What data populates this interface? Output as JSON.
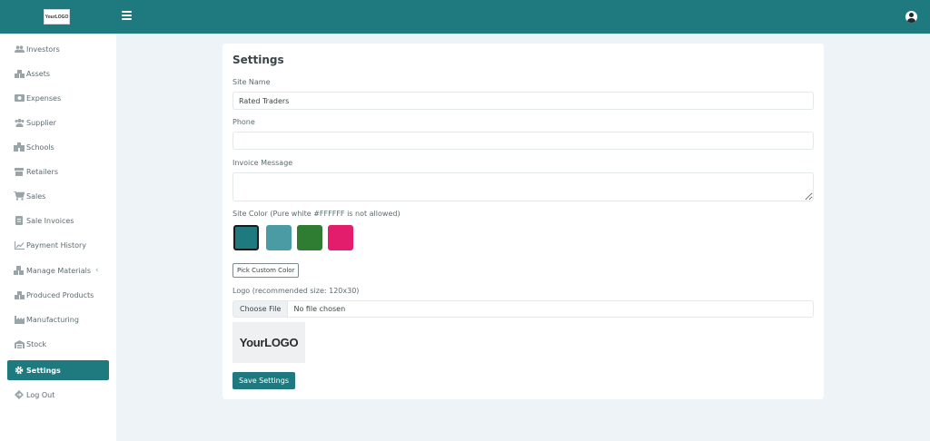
{
  "header": {
    "logo_text": "YourLOGO",
    "menu_icon": "hamburger-icon",
    "user_icon": "user-avatar-icon"
  },
  "sidebar": {
    "items": [
      {
        "label": "Investors",
        "icon": "users-icon"
      },
      {
        "label": "Assets",
        "icon": "boxes-icon"
      },
      {
        "label": "Expenses",
        "icon": "money-icon"
      },
      {
        "label": "Supplier",
        "icon": "users-group-icon"
      },
      {
        "label": "Schools",
        "icon": "school-icon"
      },
      {
        "label": "Retailers",
        "icon": "store-icon"
      },
      {
        "label": "Sales",
        "icon": "cart-icon"
      },
      {
        "label": "Sale Invoices",
        "icon": "invoice-icon"
      },
      {
        "label": "Payment History",
        "icon": "chart-line-icon"
      },
      {
        "label": "Manage Materials",
        "icon": "cubes-icon"
      },
      {
        "label": "Produced Products",
        "icon": "boxes-icon"
      },
      {
        "label": "Manufacturing",
        "icon": "industry-icon"
      },
      {
        "label": "Stock",
        "icon": "warehouse-icon"
      },
      {
        "label": "Settings",
        "icon": "gear-icon",
        "active": true
      },
      {
        "label": "Log Out",
        "icon": "logout-icon"
      }
    ],
    "submenu_chevron": "‹"
  },
  "settings": {
    "title": "Settings",
    "site_name_label": "Site Name",
    "site_name_value": "Rated Traders",
    "phone_label": "Phone",
    "phone_value": "",
    "invoice_message_label": "Invoice Message",
    "invoice_message_value": "",
    "site_color_label": "Site Color (Pure white #FFFFFF is not allowed)",
    "colors": [
      "#1f7a80",
      "#4a9ba3",
      "#2e7d32",
      "#e31c6c"
    ],
    "selected_color": "#1f7a80",
    "pick_custom_label": "Pick Custom Color",
    "logo_label": "Logo (recommended size: 120x30)",
    "choose_file_label": "Choose File",
    "file_status": "No file chosen",
    "logo_preview_text": "YourLOGO",
    "save_label": "Save Settings"
  }
}
